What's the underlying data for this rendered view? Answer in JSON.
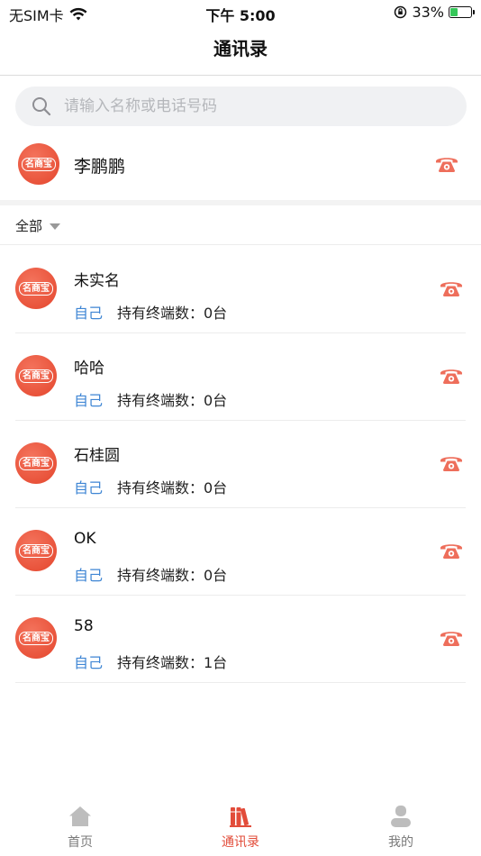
{
  "status_bar": {
    "carrier": "无SIM卡",
    "time": "下午 5:00",
    "battery_percent": "33%",
    "battery_level": 0.33
  },
  "nav": {
    "title": "通讯录"
  },
  "search": {
    "placeholder": "请输入名称或电话号码",
    "value": ""
  },
  "avatar_badge": "名商宝",
  "self": {
    "name": "李鹏鹏"
  },
  "filter": {
    "label": "全部"
  },
  "contacts": [
    {
      "name": "未实名",
      "tag": "自己",
      "terminals": "持有终端数：0台"
    },
    {
      "name": "哈哈",
      "tag": "自己",
      "terminals": "持有终端数：0台"
    },
    {
      "name": "石桂圆",
      "tag": "自己",
      "terminals": "持有终端数：0台"
    },
    {
      "name": "OK",
      "tag": "自己",
      "terminals": "持有终端数：0台"
    },
    {
      "name": "58",
      "tag": "自己",
      "terminals": "持有终端数：1台"
    }
  ],
  "tabs": [
    {
      "label": "首页",
      "icon": "home-icon",
      "active": false
    },
    {
      "label": "通讯录",
      "icon": "books-icon",
      "active": true
    },
    {
      "label": "我的",
      "icon": "user-icon",
      "active": false
    }
  ],
  "colors": {
    "accent": "#e24c3a",
    "phone": "#ee6e5b",
    "tag": "#3f86d4",
    "inactive_tab": "#bdbdbd"
  }
}
